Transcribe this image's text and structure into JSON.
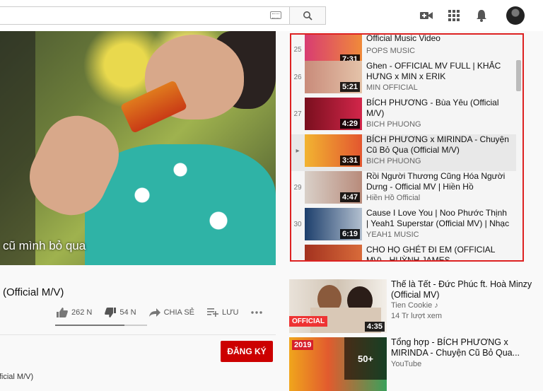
{
  "header": {
    "search_placeholder": "",
    "icons": [
      "keyboard-icon",
      "search-icon",
      "camera-icon",
      "apps-icon",
      "bell-icon"
    ]
  },
  "video": {
    "subtitle": "cũ mình bỏ qua",
    "title": "(Official M/V)",
    "likes": "262 N",
    "dislikes": "54 N",
    "share_label": "CHIA SẺ",
    "save_label": "LƯU",
    "like_ratio": 0.75,
    "subscribe_label": "ĐĂNG KÝ",
    "description_fragment": "fficial M/V)"
  },
  "playlist": {
    "items": [
      {
        "index": "25",
        "title": "Official Music Video",
        "channel": "POPS MUSIC",
        "duration": "7:31"
      },
      {
        "index": "26",
        "title": "Ghen - OFFICIAL MV FULL | KHẮC HƯNG x MIN x ERIK",
        "channel": "MIN OFFICIAL",
        "duration": "5:21"
      },
      {
        "index": "27",
        "title": "BÍCH PHƯƠNG - Bùa Yêu (Official M/V)",
        "channel": "BICH PHUONG",
        "duration": "4:29"
      },
      {
        "index": "▸",
        "title": "BÍCH PHƯƠNG x MIRINDA - Chuyện Cũ Bỏ Qua (Official M/V)",
        "channel": "BICH PHUONG",
        "duration": "3:31"
      },
      {
        "index": "29",
        "title": "Rồi Người Thương Cũng Hóa Người Dưng - Official MV | Hiền Hồ",
        "channel": "Hiền Hồ Official",
        "duration": "4:47"
      },
      {
        "index": "30",
        "title": "Cause I Love You | Noo Phước Thịnh | Yeah1 Superstar (Official MV) | Nhạc ...",
        "channel": "YEAH1 MUSIC",
        "duration": "6:19"
      },
      {
        "index": "",
        "title": "CHO HỌ GHÉT ĐI EM (OFFICIAL MV) - HUỲNH JAMES",
        "channel": "",
        "duration": ""
      }
    ]
  },
  "recommended": [
    {
      "title": "Thế là Tết - Đức Phúc ft. Hoà Minzy (Official MV)",
      "channel": "Tien Cookie ♪",
      "views": "14 Tr lượt xem",
      "duration": "4:35",
      "badge": "OFFICIAL"
    },
    {
      "title": "Tổng hợp - BÍCH PHƯƠNG x MIRINDA - Chuyện Cũ Bỏ Qua...",
      "channel": "YouTube",
      "views": "",
      "duration": "",
      "badge": "50+"
    }
  ]
}
